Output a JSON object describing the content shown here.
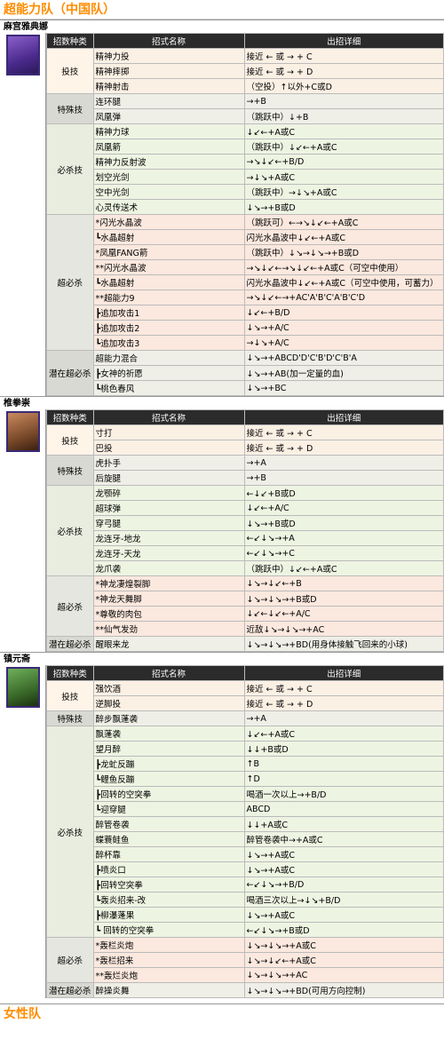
{
  "page_title": "超能力队（中国队）",
  "next_title": "女性队",
  "headers": {
    "cat": "招数种类",
    "name": "招式名称",
    "detail": "出招详细"
  },
  "characters": [
    {
      "name": "麻宫雅典娜",
      "groups": [
        {
          "cat": "投技",
          "rows": [
            {
              "n": "精神力投",
              "d": "接近 ← 或 → + C"
            },
            {
              "n": "精神摔掷",
              "d": "接近 ← 或 → + D"
            },
            {
              "n": "精神射击",
              "d": "（空投）↑以外+C或D"
            }
          ]
        },
        {
          "cat": "特殊技",
          "rows": [
            {
              "n": "连环腿",
              "d": "→+B"
            },
            {
              "n": "凤凰弹",
              "d": "（跳跃中）↓+B"
            }
          ]
        },
        {
          "cat": "必杀技",
          "rows": [
            {
              "n": "精神力球",
              "d": "↓↙←+A或C"
            },
            {
              "n": "凤凰箭",
              "d": "（跳跃中）↓↙←+A或C"
            },
            {
              "n": "精神力反射波",
              "d": "→↘↓↙←+B/D"
            },
            {
              "n": "划空光剑",
              "d": "→↓↘+A或C"
            },
            {
              "n": "空中光剑",
              "d": "（跳跃中）→↓↘+A或C"
            },
            {
              "n": "心灵传送术",
              "d": "↓↘→+B或D"
            }
          ]
        },
        {
          "cat": "超必杀",
          "rows": [
            {
              "n": "*闪光水晶波",
              "d": "（跳跃可）←→↘↓↙←+A或C"
            },
            {
              "n": "┗水晶超射",
              "d": "闪光水晶波中↓↙←+A或C"
            },
            {
              "n": "*凤凰FANG箭",
              "d": "（跳跃中）↓↘→↓↘→+B或D"
            },
            {
              "n": "**闪光水晶波",
              "d": "→↘↓↙←→↘↓↙←+A或C（可空中使用）"
            },
            {
              "n": "┗水晶超射",
              "d": "闪光水晶波中↓↙←+A或C（可空中使用，可蓄力）"
            },
            {
              "n": "**超能力9",
              "d": "→↘↓↙←→+AC'A'B'C'A'B'C'D"
            },
            {
              "n": "┣追加攻击1",
              "d": "↓↙←+B/D"
            },
            {
              "n": "┣追加攻击2",
              "d": "↓↘→+A/C"
            },
            {
              "n": "┗追加攻击3",
              "d": "→↓↘+A/C"
            }
          ]
        },
        {
          "cat": "潜在超必杀",
          "rows": [
            {
              "n": "超能力混合",
              "d": "↓↘→+ABCD'D'C'B'D'C'B'A"
            },
            {
              "n": "┣女神的祈愿",
              "d": "↓↘→+AB(加一定量的血)"
            },
            {
              "n": "┗桃色春风",
              "d": "↓↘→+BC"
            }
          ]
        }
      ]
    },
    {
      "name": "椎拳崇",
      "groups": [
        {
          "cat": "投技",
          "rows": [
            {
              "n": "寸打",
              "d": "接近 ← 或 → + C"
            },
            {
              "n": "巴投",
              "d": "接近 ← 或 → + D"
            }
          ]
        },
        {
          "cat": "特殊技",
          "rows": [
            {
              "n": "虎扑手",
              "d": "→+A"
            },
            {
              "n": "后旋腿",
              "d": "→+B"
            }
          ]
        },
        {
          "cat": "必杀技",
          "rows": [
            {
              "n": "龙颚碎",
              "d": "←↓↙+B或D"
            },
            {
              "n": "超球弹",
              "d": "↓↙←+A/C"
            },
            {
              "n": "穿弓腿",
              "d": "↓↘→+B或D"
            },
            {
              "n": "龙连牙-地龙",
              "d": "←↙↓↘→+A"
            },
            {
              "n": "龙连牙-天龙",
              "d": "←↙↓↘→+C"
            },
            {
              "n": "龙爪袭",
              "d": "（跳跃中）↓↙←+A或C"
            }
          ]
        },
        {
          "cat": "超必杀",
          "rows": [
            {
              "n": "*神龙凄煌裂脚",
              "d": "↓↘→↓↙←+B"
            },
            {
              "n": "*神龙天舞脚",
              "d": "↓↘→↓↘→+B或D"
            },
            {
              "n": "*尊敬的肉包",
              "d": "↓↙←↓↙←+A/C"
            },
            {
              "n": "**仙气发劲",
              "d": "近敌↓↘→↓↘→+AC"
            }
          ]
        },
        {
          "cat": "潜在超必杀",
          "rows": [
            {
              "n": "醒眼来龙",
              "d": "↓↘→↓↘→+BD(用身体接触飞回来的小球)"
            }
          ]
        }
      ]
    },
    {
      "name": "镇元斋",
      "groups": [
        {
          "cat": "投技",
          "rows": [
            {
              "n": "强饮酒",
              "d": "接近 ← 或 → + C"
            },
            {
              "n": "逆脚投",
              "d": "接近 ← 或 → + D"
            }
          ]
        },
        {
          "cat": "特殊技",
          "rows": [
            {
              "n": "醉步飘蓬袭",
              "d": "→+A"
            }
          ]
        },
        {
          "cat": "必杀技",
          "rows": [
            {
              "n": "飘蓬袭",
              "d": "↓↙←+A或C"
            },
            {
              "n": "望月醉",
              "d": "↓↓+B或D"
            },
            {
              "n": "┣龙虻反蹦",
              "d": "↑B"
            },
            {
              "n": "┗鲤鱼反蹦",
              "d": "↑D"
            },
            {
              "n": "┣回转的空突拳",
              "d": "喝酒一次以上→+B/D"
            },
            {
              "n": "┗迎穿腿",
              "d": "ABCD"
            },
            {
              "n": "醉管卷袭",
              "d": "↓↓+A或C"
            },
            {
              "n": "蝶蓑鲑鱼",
              "d": "醉管卷袭中→+A或C"
            },
            {
              "n": "醉杯靠",
              "d": "↓↘→+A或C"
            },
            {
              "n": "┣喷炎口",
              "d": "↓↘→+A或C"
            },
            {
              "n": "┣回转空突拳",
              "d": "←↙↓↘→+B/D"
            },
            {
              "n": "┗轰炎招来-改",
              "d": "喝酒三次以上→↓↘+B/D"
            },
            {
              "n": "┣柳瀑蓬果",
              "d": "↓↘→+A或C"
            },
            {
              "n": "┗ 回转的空突拳",
              "d": "←↙↓↘→+B或D"
            }
          ]
        },
        {
          "cat": "超必杀",
          "rows": [
            {
              "n": "*轰栏炎炮",
              "d": "↓↘→↓↘→+A或C"
            },
            {
              "n": "*轰栏招来",
              "d": "↓↘→↓↙←+A或C"
            },
            {
              "n": "**轰烂炎炮",
              "d": "↓↘→↓↘→+AC"
            }
          ]
        },
        {
          "cat": "潜在超必杀",
          "rows": [
            {
              "n": "醉操炎舞",
              "d": "↓↘→↓↘→+BD(可用方向控制)"
            }
          ]
        }
      ]
    }
  ]
}
